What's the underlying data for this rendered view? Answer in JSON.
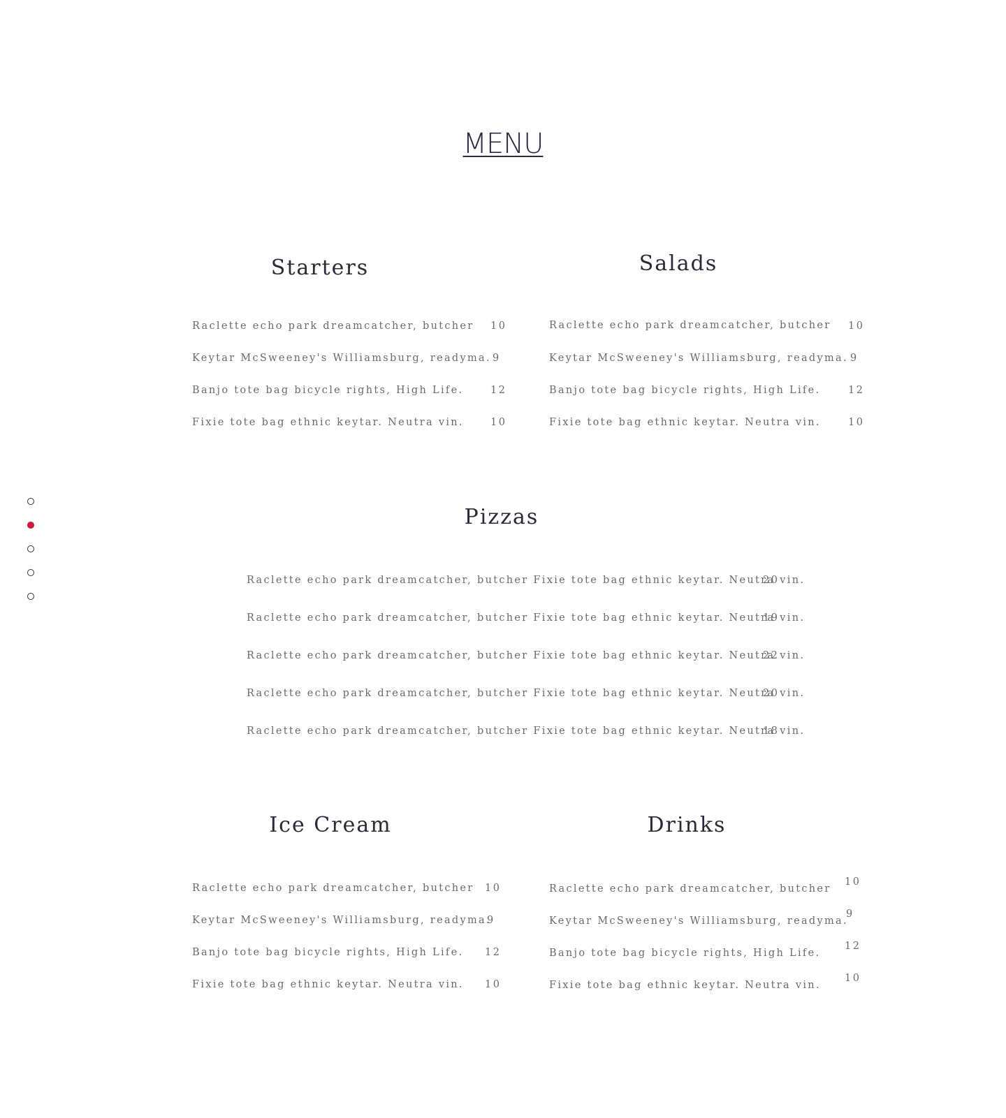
{
  "title": "MENU",
  "nav_dots": [
    {
      "label": "section-1",
      "active": false
    },
    {
      "label": "section-2",
      "active": true
    },
    {
      "label": "section-3",
      "active": false
    },
    {
      "label": "section-4",
      "active": false
    },
    {
      "label": "section-5",
      "active": false
    }
  ],
  "starters": {
    "title": "Starters",
    "items": [
      {
        "name": "Raclette echo park dreamcatcher, butcher",
        "price": "10"
      },
      {
        "name": "Keytar McSweeney's Williamsburg, readyma.",
        "price": "9"
      },
      {
        "name": "Banjo tote bag bicycle rights, High Life.",
        "price": "12"
      },
      {
        "name": "Fixie tote bag ethnic keytar. Neutra vin.",
        "price": "10"
      }
    ]
  },
  "salads": {
    "title": "Salads",
    "items": [
      {
        "name": "Raclette echo park dreamcatcher, butcher",
        "price": "10"
      },
      {
        "name": "Keytar McSweeney's Williamsburg, readyma.",
        "price": "9"
      },
      {
        "name": "Banjo tote bag bicycle rights, High Life.",
        "price": "12"
      },
      {
        "name": "Fixie tote bag ethnic keytar. Neutra vin.",
        "price": "10"
      }
    ]
  },
  "pizzas": {
    "title": "Pizzas",
    "items": [
      {
        "name": "Raclette echo park dreamcatcher, butcher Fixie tote bag ethnic keytar. Neutra vin.",
        "price": "20"
      },
      {
        "name": "Raclette echo park dreamcatcher, butcher Fixie tote bag ethnic keytar. Neutra vin.",
        "price": "19"
      },
      {
        "name": "Raclette echo park dreamcatcher, butcher Fixie tote bag ethnic keytar. Neutra vin.",
        "price": "22"
      },
      {
        "name": "Raclette echo park dreamcatcher, butcher Fixie tote bag ethnic keytar. Neutra vin.",
        "price": "20"
      },
      {
        "name": "Raclette echo park dreamcatcher, butcher Fixie tote bag ethnic keytar. Neutra vin.",
        "price": "18"
      }
    ]
  },
  "ice_cream": {
    "title": "Ice Cream",
    "items": [
      {
        "name": "Raclette echo park dreamcatcher, butcher",
        "price": "10"
      },
      {
        "name": "Keytar McSweeney's Williamsburg, readyma.",
        "price": "9"
      },
      {
        "name": "Banjo tote bag bicycle rights, High Life.",
        "price": "12"
      },
      {
        "name": "Fixie tote bag ethnic keytar. Neutra vin.",
        "price": "10"
      }
    ]
  },
  "drinks": {
    "title": "Drinks",
    "items": [
      {
        "name": "Raclette echo park dreamcatcher, butcher",
        "price": "10"
      },
      {
        "name": "Keytar McSweeney's Williamsburg, readyma.",
        "price": "9"
      },
      {
        "name": "Banjo tote bag bicycle rights, High Life.",
        "price": "12"
      },
      {
        "name": "Fixie tote bag ethnic keytar. Neutra vin.",
        "price": "10"
      }
    ]
  },
  "colors": {
    "accent": "#d0163a",
    "heading": "#2a2b3a",
    "body_text": "#6a6a6a"
  }
}
